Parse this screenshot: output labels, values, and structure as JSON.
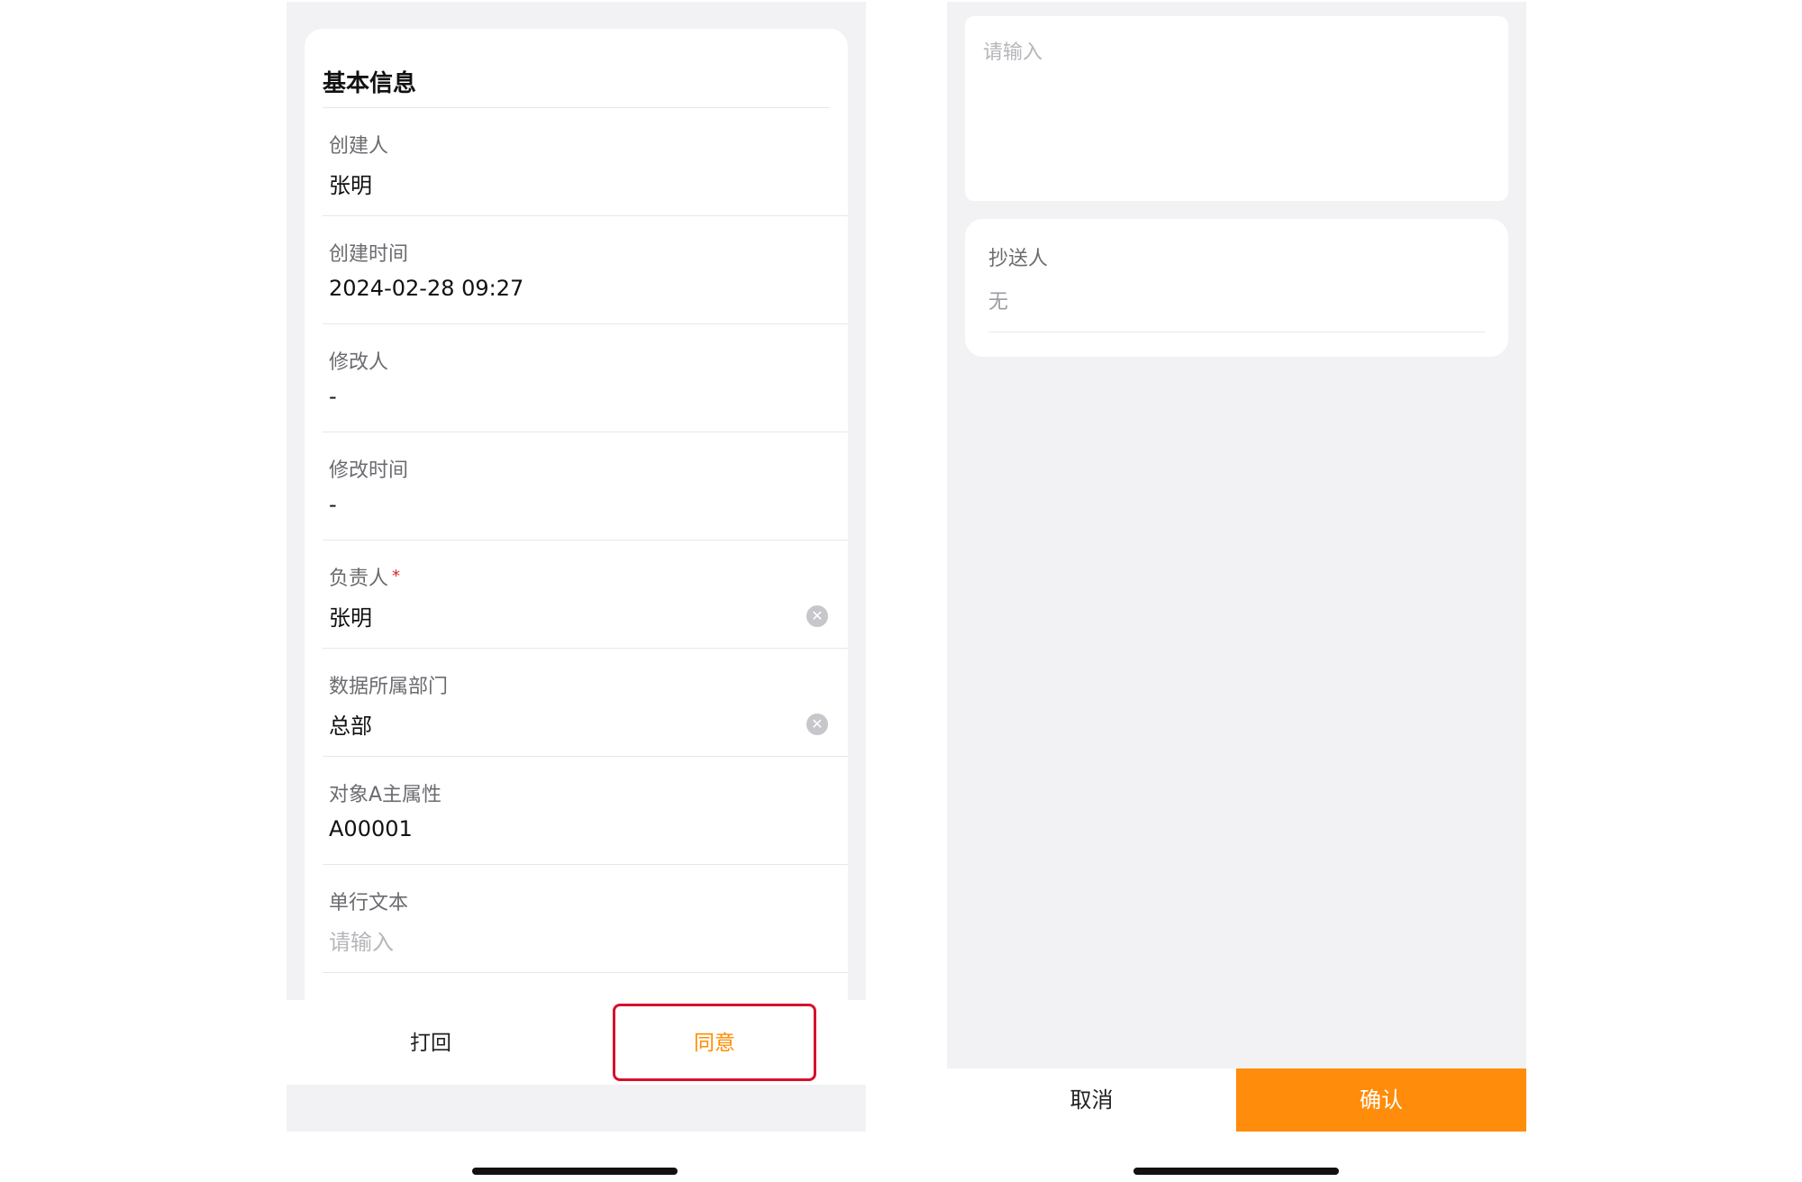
{
  "left_screen": {
    "section_title": "基本信息",
    "fields": [
      {
        "label": "创建人",
        "value": "张明",
        "placeholder": false,
        "required": false,
        "clearable": false
      },
      {
        "label": "创建时间",
        "value": "2024-02-28 09:27",
        "placeholder": false,
        "required": false,
        "clearable": false
      },
      {
        "label": "修改人",
        "value": "-",
        "placeholder": false,
        "required": false,
        "clearable": false
      },
      {
        "label": "修改时间",
        "value": "-",
        "placeholder": false,
        "required": false,
        "clearable": false
      },
      {
        "label": "负责人",
        "value": "张明",
        "placeholder": false,
        "required": true,
        "clearable": true
      },
      {
        "label": "数据所属部门",
        "value": "总部",
        "placeholder": false,
        "required": false,
        "clearable": true
      },
      {
        "label": "对象A主属性",
        "value": "A00001",
        "placeholder": false,
        "required": false,
        "clearable": false
      },
      {
        "label": "单行文本",
        "value": "请输入",
        "placeholder": true,
        "required": false,
        "clearable": false
      }
    ],
    "required_mark": "*",
    "clear_icon": "✕",
    "actions": {
      "reject_label": "打回",
      "agree_label": "同意"
    }
  },
  "right_screen": {
    "comment_placeholder": "请输入",
    "cc": {
      "label": "抄送人",
      "value": "无"
    },
    "actions": {
      "cancel_label": "取消",
      "confirm_label": "确认"
    }
  },
  "colors": {
    "accent": "#ff8c0a",
    "highlight_border": "#d6112b",
    "background": "#f2f2f5"
  }
}
